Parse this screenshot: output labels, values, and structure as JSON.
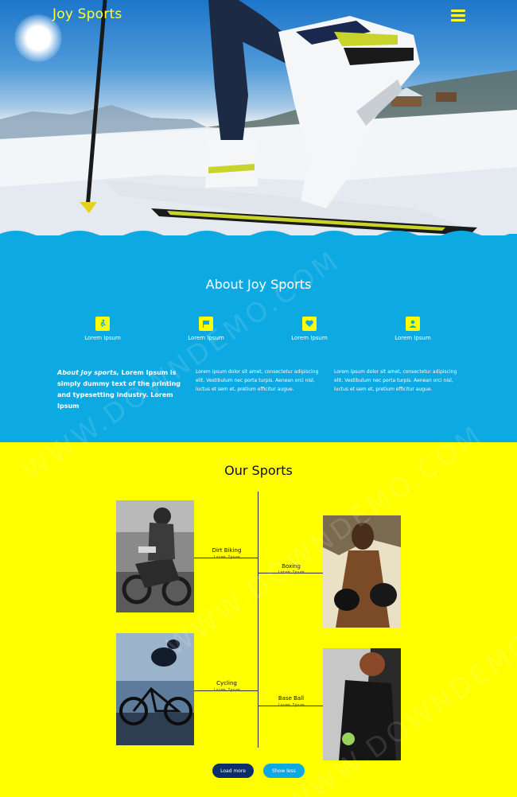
{
  "header": {
    "brand": "Joy Sports",
    "menu_icon": "hamburger-icon"
  },
  "about": {
    "title": "About Joy Sports",
    "features": [
      {
        "icon": "running-icon",
        "label": "Lorem Ipsum"
      },
      {
        "icon": "flag-icon",
        "label": "Lorem Ipsum"
      },
      {
        "icon": "heart-icon",
        "label": "Lorem Ipsum"
      },
      {
        "icon": "user-icon",
        "label": "Lorem Ipsum"
      }
    ],
    "lead_prefix": "About Joy sports,",
    "lead_text": "Lorem Ipsum is simply dummy text of the printing and typesetting industry. Lorem Ipsum",
    "col1": "Lorem ipsum dolor sit amet, consectetur adipiscing elit. Vestibulum nec porta turpis. Aenean orci nisl, luctus et sem et, pretium efficitur augue.",
    "col2": "Lorem ipsum dolor sit amet, consectetur adipiscing elit. Vestibulum nec porta turpis. Aenean orci nisl, luctus et sem et, pretium efficitur augue."
  },
  "sports": {
    "title": "Our Sports",
    "items": [
      {
        "title": "Dirt Biking",
        "sub": "Lorem Ipsum"
      },
      {
        "title": "Boxing",
        "sub": "Lorem Ipsum"
      },
      {
        "title": "Cycling",
        "sub": "Lorem Ipsum"
      },
      {
        "title": "Base Ball",
        "sub": "Lorem Ipsum"
      }
    ],
    "load_more": "Load more",
    "show_less": "Show less"
  },
  "colors": {
    "accent_blue": "#0da9e2",
    "accent_yellow": "#ffff00",
    "dark_button": "#0c2e6b"
  },
  "watermark": "WWW.DOWNDEMO.COM"
}
